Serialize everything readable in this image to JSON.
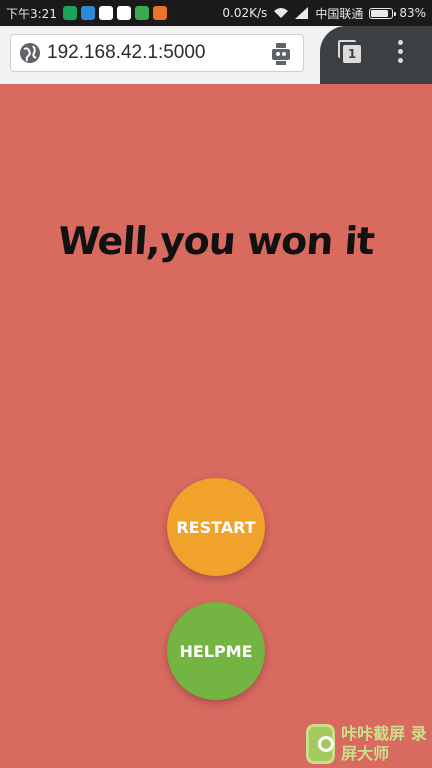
{
  "status_bar": {
    "time": "下午3:21",
    "net_speed": "0.02K/s",
    "carrier": "中国联通",
    "battery_percent": "83%",
    "battery_level": 0.83,
    "app_icon_colors": [
      "#1aa35b",
      "#2d8ad6",
      "#ffffff",
      "#ffffff",
      "#3aa84b",
      "#e8732a"
    ]
  },
  "browser": {
    "url": "192.168.42.1:5000",
    "tab_count": "1"
  },
  "game": {
    "message": "Well,you won it",
    "restart_label": "RESTART",
    "helpme_label": "HELPME",
    "background_color": "#d96a60",
    "restart_color": "#f1a22b",
    "helpme_color": "#74b443"
  },
  "watermark": {
    "text": "咔咔截屏 录屏大师"
  }
}
